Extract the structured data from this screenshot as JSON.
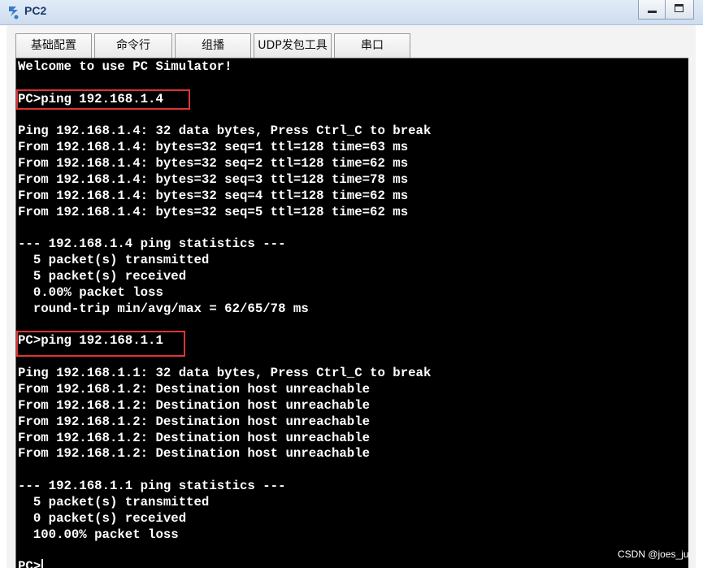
{
  "window": {
    "title": "PC2",
    "icon": "pc-simulator-icon",
    "minimize_icon": "minimize-icon",
    "maximize_icon": "maximize-icon"
  },
  "tabs": [
    {
      "label": "基础配置"
    },
    {
      "label": "命令行",
      "active": true
    },
    {
      "label": "组播"
    },
    {
      "label": "UDP发包工具"
    },
    {
      "label": "串口"
    }
  ],
  "terminal": {
    "lines": [
      "Welcome to use PC Simulator!",
      "",
      "PC>ping 192.168.1.4",
      "",
      "Ping 192.168.1.4: 32 data bytes, Press Ctrl_C to break",
      "From 192.168.1.4: bytes=32 seq=1 ttl=128 time=63 ms",
      "From 192.168.1.4: bytes=32 seq=2 ttl=128 time=62 ms",
      "From 192.168.1.4: bytes=32 seq=3 ttl=128 time=78 ms",
      "From 192.168.1.4: bytes=32 seq=4 ttl=128 time=62 ms",
      "From 192.168.1.4: bytes=32 seq=5 ttl=128 time=62 ms",
      "",
      "--- 192.168.1.4 ping statistics ---",
      "  5 packet(s) transmitted",
      "  5 packet(s) received",
      "  0.00% packet loss",
      "  round-trip min/avg/max = 62/65/78 ms",
      "",
      "PC>ping 192.168.1.1",
      "",
      "Ping 192.168.1.1: 32 data bytes, Press Ctrl_C to break",
      "From 192.168.1.2: Destination host unreachable",
      "From 192.168.1.2: Destination host unreachable",
      "From 192.168.1.2: Destination host unreachable",
      "From 192.168.1.2: Destination host unreachable",
      "From 192.168.1.2: Destination host unreachable",
      "",
      "--- 192.168.1.1 ping statistics ---",
      "  5 packet(s) transmitted",
      "  0 packet(s) received",
      "  100.00% packet loss",
      "",
      "PC>"
    ],
    "highlighted_commands": [
      "PC>ping 192.168.1.4",
      "PC>ping 192.168.1.1"
    ],
    "highlight_color": "#e03434",
    "background": "#000000",
    "foreground": "#ffffff"
  },
  "watermark": "CSDN @joes_ju"
}
